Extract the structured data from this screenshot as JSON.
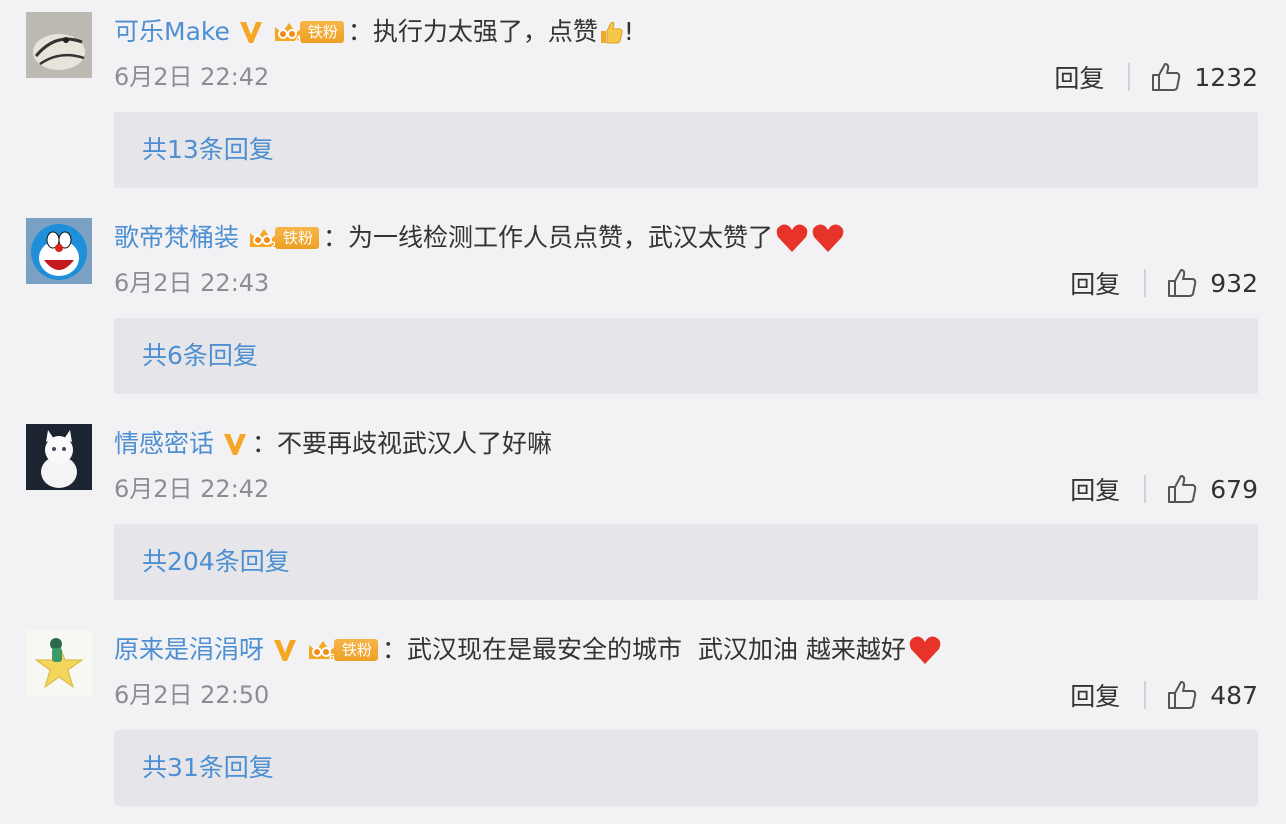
{
  "comments": [
    {
      "username": "可乐Make",
      "verified": true,
      "fan_level": "4",
      "fan_label": "铁粉",
      "text": "执行力太强了，点赞",
      "text_tail": "!",
      "emojis": [
        "thumbs-up"
      ],
      "time": "6月2日 22:42",
      "reply_label": "回复",
      "likes": "1232",
      "replies_link": "共13条回复"
    },
    {
      "username": "歌帝梵桶装",
      "verified": false,
      "fan_level": "2",
      "fan_label": "铁粉",
      "text": "为一线检测工作人员点赞，武汉太赞了",
      "emojis": [
        "heart",
        "heart"
      ],
      "time": "6月2日 22:43",
      "reply_label": "回复",
      "likes": "932",
      "replies_link": "共6条回复"
    },
    {
      "username": "情感密话",
      "verified": true,
      "text": "不要再歧视武汉人了好嘛",
      "emojis": [],
      "time": "6月2日 22:42",
      "reply_label": "回复",
      "likes": "679",
      "replies_link": "共204条回复"
    },
    {
      "username": "原来是涓涓呀",
      "verified": true,
      "fan_level": "6",
      "fan_label": "铁粉",
      "text": "武汉现在是最安全的城市  武汉加油 越来越好",
      "emojis": [
        "heart"
      ],
      "time": "6月2日 22:50",
      "reply_label": "回复",
      "likes": "487",
      "replies_link": "共31条回复"
    }
  ],
  "colors": {
    "link": "#4d8fd1",
    "background": "#f2f2f5",
    "reply_box": "#e6e6ea",
    "vip_badge": "#f5a623",
    "heart": "#e8332a"
  }
}
